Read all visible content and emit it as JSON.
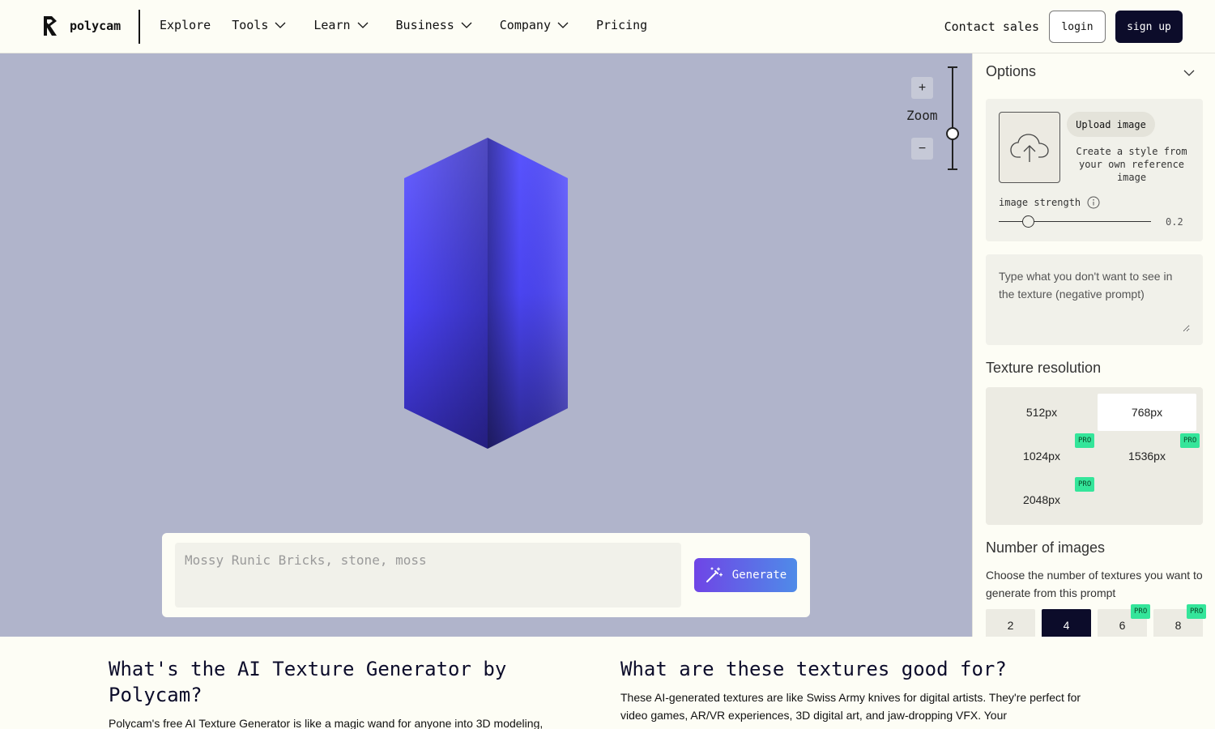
{
  "header": {
    "brand": "polycam",
    "nav": [
      {
        "label": "Explore",
        "dropdown": false
      },
      {
        "label": "Tools",
        "dropdown": true
      },
      {
        "label": "Learn",
        "dropdown": true
      },
      {
        "label": "Business",
        "dropdown": true
      },
      {
        "label": "Company",
        "dropdown": true
      },
      {
        "label": "Pricing",
        "dropdown": false
      }
    ],
    "contact": "Contact sales",
    "login": "login",
    "signup": "sign up"
  },
  "viewport": {
    "background": "#b0b4cb",
    "zoom": {
      "plus": "+",
      "label": "Zoom",
      "minus": "−"
    },
    "prompt_placeholder": "Mossy Runic Bricks, stone, moss",
    "generate_label": "Generate"
  },
  "sidebar": {
    "options_title": "Options",
    "upload_button": "Upload image",
    "upload_desc": "Create a style from your own reference image",
    "strength_label": "image strength",
    "strength_value": "0.2",
    "negative_placeholder": "Type what you don't want to see in the texture (negative prompt)",
    "resolution_title": "Texture resolution",
    "resolutions": [
      {
        "label": "512px",
        "selected": false,
        "pro": false
      },
      {
        "label": "768px",
        "selected": true,
        "pro": false
      },
      {
        "label": "1024px",
        "selected": false,
        "pro": true
      },
      {
        "label": "1536px",
        "selected": false,
        "pro": true
      },
      {
        "label": "2048px",
        "selected": false,
        "pro": true
      }
    ],
    "pro_badge": "PRO",
    "num_images_title": "Number of images",
    "num_images_desc": "Choose the number of textures you want to generate from this prompt",
    "num_images": [
      {
        "label": "2",
        "selected": false,
        "pro": false
      },
      {
        "label": "4",
        "selected": true,
        "pro": false
      },
      {
        "label": "6",
        "selected": false,
        "pro": true
      },
      {
        "label": "8",
        "selected": false,
        "pro": true
      }
    ]
  },
  "content": {
    "left_heading": "What's the AI Texture Generator by Polycam?",
    "left_text": "Polycam's free AI Texture Generator is like a magic wand for anyone into 3D modeling,",
    "right_heading": "What are these textures good for?",
    "right_text": "These AI-generated textures are like Swiss Army knives for digital artists. They're perfect for video games, AR/VR experiences, 3D digital art, and jaw-dropping VFX. Your"
  },
  "colors": {
    "accent_dark": "#0c0c2a",
    "pro_green": "#34e59a",
    "prism_light": "#6a63ff",
    "prism_dark": "#2c2890"
  }
}
